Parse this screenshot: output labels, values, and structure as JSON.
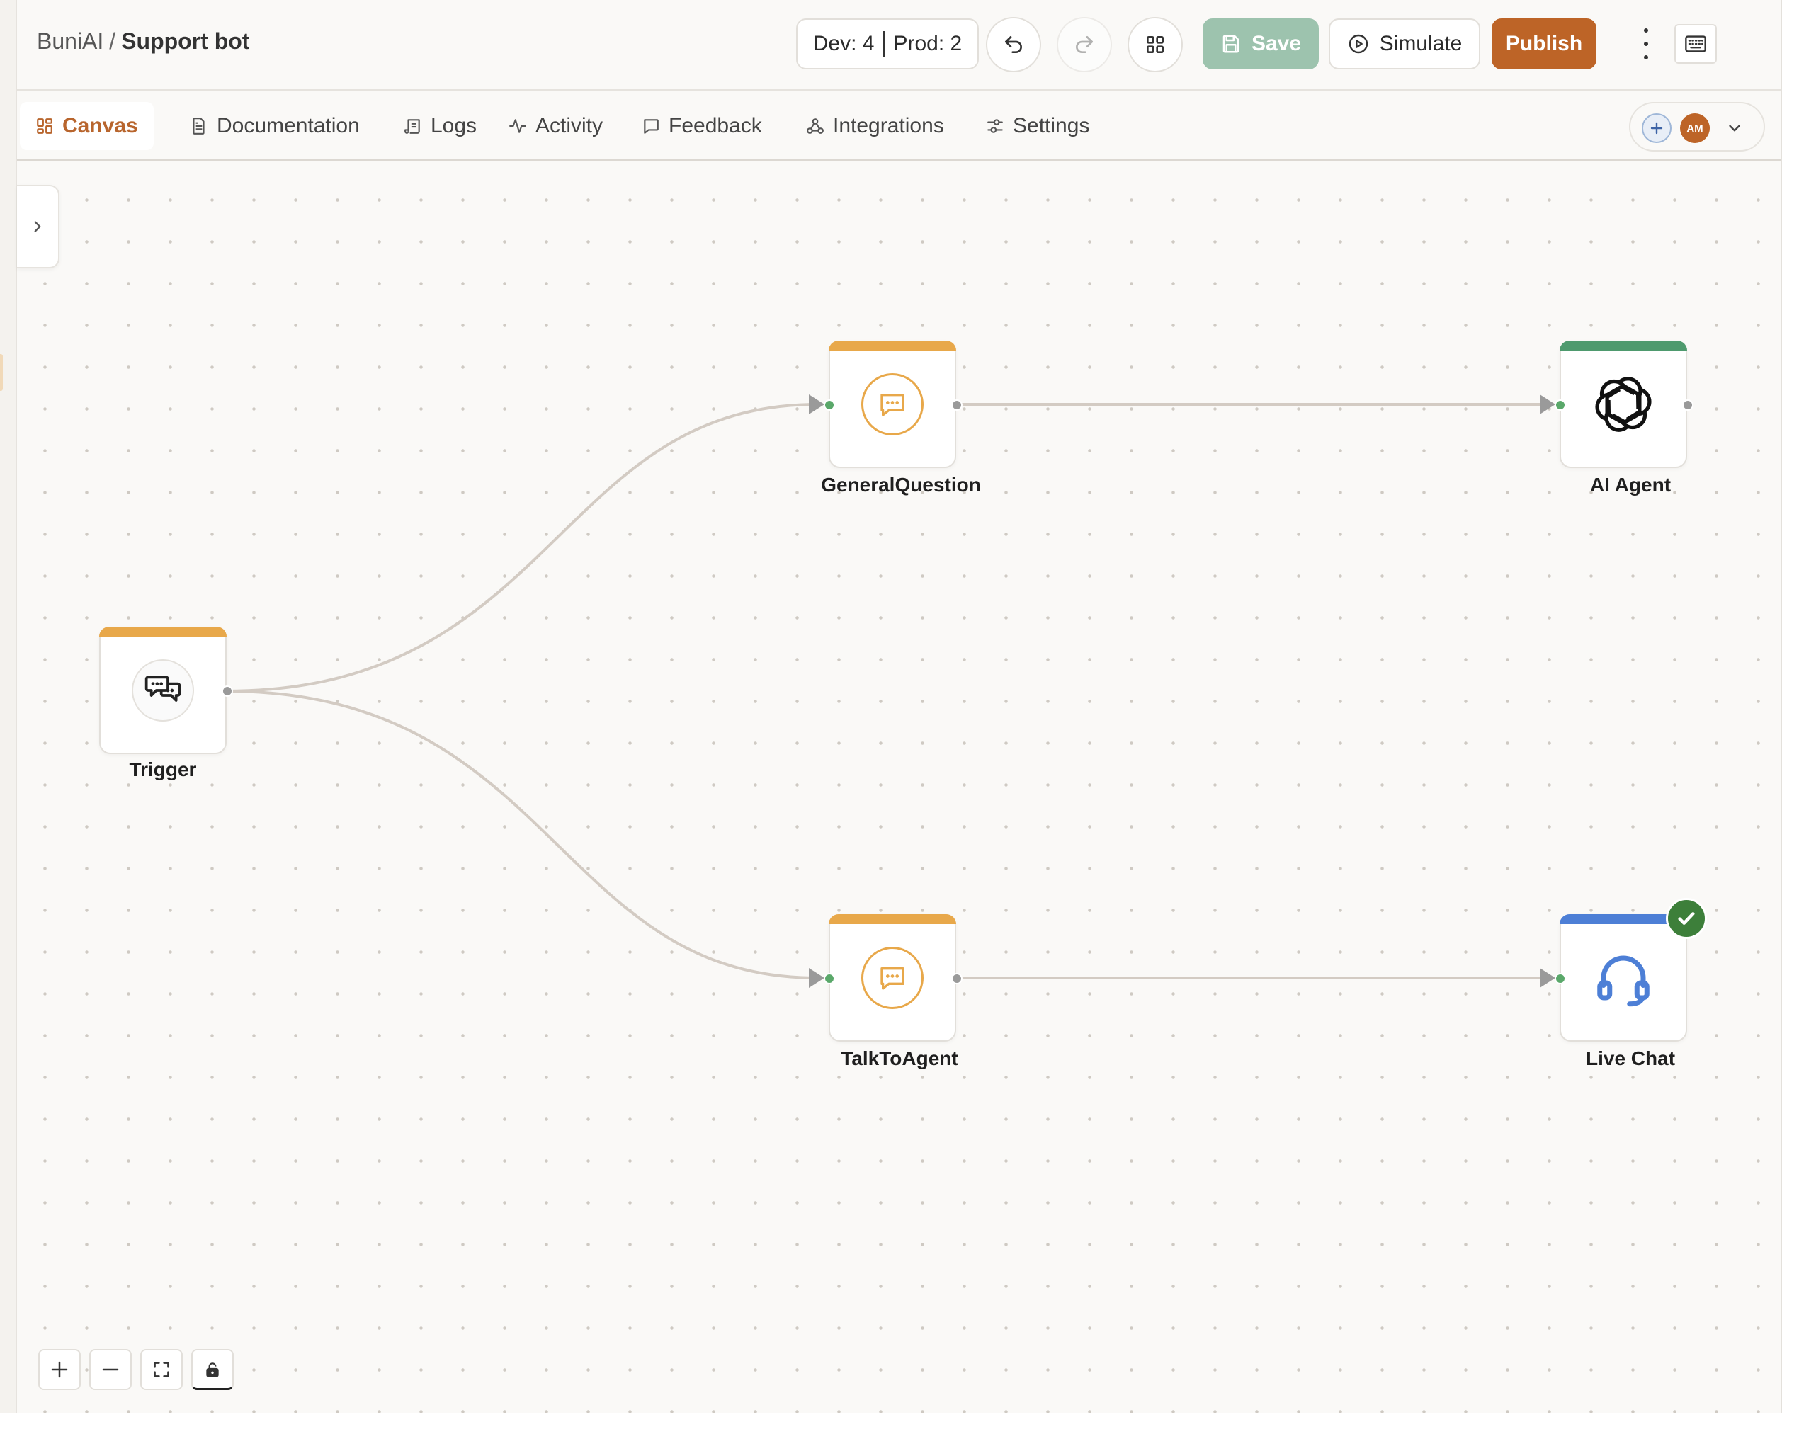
{
  "header": {
    "workspace": "BuniAI",
    "separator": "/",
    "project": "Support bot",
    "version_dev": "Dev: 4",
    "version_prod": "Prod: 2",
    "save_label": "Save",
    "simulate_label": "Simulate",
    "publish_label": "Publish"
  },
  "tabs": [
    {
      "label": "Canvas",
      "icon": "grid-icon",
      "active": true
    },
    {
      "label": "Documentation",
      "icon": "document-icon"
    },
    {
      "label": "Logs",
      "icon": "scroll-icon"
    },
    {
      "label": "Activity",
      "icon": "pulse-icon"
    },
    {
      "label": "Feedback",
      "icon": "message-icon"
    },
    {
      "label": "Integrations",
      "icon": "share-nodes-icon"
    },
    {
      "label": "Settings",
      "icon": "sliders-icon"
    }
  ],
  "collaborators": {
    "avatar_initials": "AM"
  },
  "nodes": {
    "trigger": {
      "label": "Trigger",
      "accent": "#e8a84a",
      "icon": "chat-bubbles-icon"
    },
    "general_question": {
      "label": "GeneralQuestion",
      "accent": "#e8a84a",
      "icon": "message-dots-icon"
    },
    "ai_agent": {
      "label": "AI Agent",
      "accent": "#4e9a6e",
      "icon": "openai-icon"
    },
    "talk_to_agent": {
      "label": "TalkToAgent",
      "accent": "#e8a84a",
      "icon": "message-dots-icon"
    },
    "live_chat": {
      "label": "Live Chat",
      "accent": "#4d7fd6",
      "icon": "headset-icon",
      "status": "completed"
    }
  },
  "colors": {
    "brand": "#bd6427",
    "save": "#9dc3ae",
    "edge": "#d3cbc3",
    "handle_in": "#5aa86a",
    "status_ok": "#3d7f3a"
  }
}
